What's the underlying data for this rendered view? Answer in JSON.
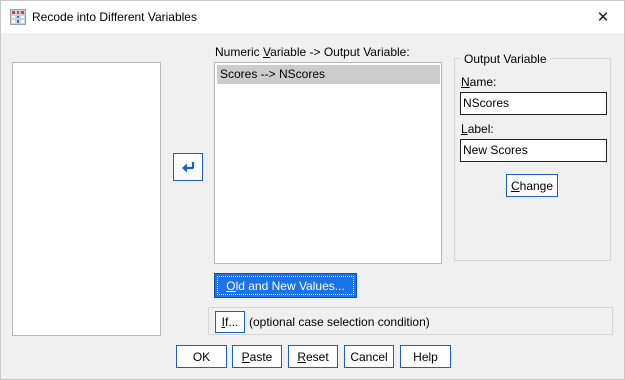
{
  "window": {
    "title": "Recode into Different Variables",
    "close_glyph": "✕",
    "app_icon": "spss-dialog-icon"
  },
  "variable_list": {
    "label_prefix": "Numeric ",
    "label_mnemonic": "V",
    "label_suffix": "ariable -> Output Variable:",
    "items": [
      "Scores --> NScores"
    ],
    "selected_index": 0
  },
  "move_button": {
    "icon": "move-arrow-icon"
  },
  "output_variable": {
    "group_title": "Output Variable",
    "name_mnemonic": "N",
    "name_rest": "ame:",
    "name_value": "NScores",
    "label_mnemonic": "L",
    "label_rest": "abel:",
    "label_value": "New Scores",
    "change_mnemonic": "C",
    "change_rest": "hange"
  },
  "old_new_values": {
    "mnemonic": "O",
    "rest": "ld and New Values..."
  },
  "if_condition": {
    "mnemonic": "I",
    "rest": "f...",
    "description": "(optional case selection condition)"
  },
  "buttons": {
    "ok": "OK",
    "paste_mnemonic": "P",
    "paste_rest": "aste",
    "reset_mnemonic": "R",
    "reset_rest": "eset",
    "cancel": "Cancel",
    "help": "Help"
  },
  "colors": {
    "accent": "#1a73e8",
    "selection": "#cccccc",
    "button_border": "#1e5fc2"
  }
}
